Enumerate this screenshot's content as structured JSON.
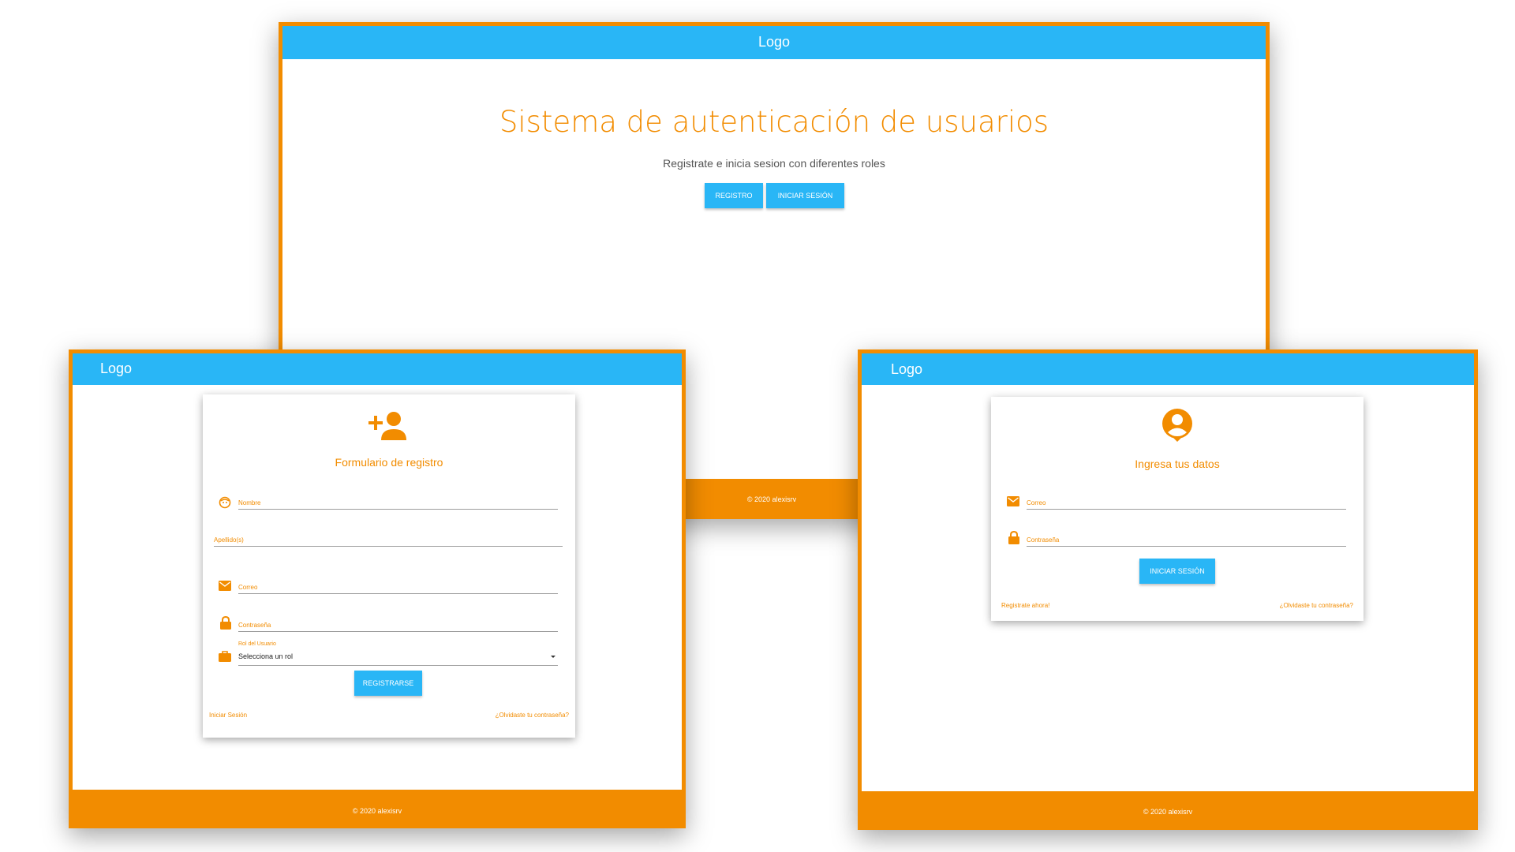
{
  "colors": {
    "brand_blue": "#29b6f6",
    "accent_orange": "#f28c00"
  },
  "home": {
    "logo": "Logo",
    "title": "Sistema de autenticación de usuarios",
    "subtitle": "Registrate e inicia sesion con diferentes roles",
    "register_btn": "REGISTRO",
    "login_btn": "INICIAR SESIÓN",
    "footer": "© 2020 alexisrv"
  },
  "register": {
    "logo": "Logo",
    "icon": "person-add-icon",
    "title": "Formulario de registro",
    "fields": {
      "nombre": "Nombre",
      "apellido": "Apellido(s)",
      "correo": "Correo",
      "contrasena": "Contraseña",
      "rol_label": "Rol del Usuario",
      "rol_value": "Selecciona un rol"
    },
    "submit": "REGISTRARSE",
    "link_login": "Iniciar Sesión",
    "link_forgot": "¿Olvidaste tu contraseña?",
    "footer": "© 2020 alexisrv"
  },
  "login": {
    "logo": "Logo",
    "icon": "account-circle-icon",
    "title": "Ingresa tus datos",
    "fields": {
      "correo": "Correo",
      "contrasena": "Contraseña"
    },
    "submit": "INICIAR SESIÓN",
    "link_register": "Registrate ahora!",
    "link_forgot": "¿Olvidaste tu contraseña?",
    "footer": "© 2020 alexisrv"
  }
}
